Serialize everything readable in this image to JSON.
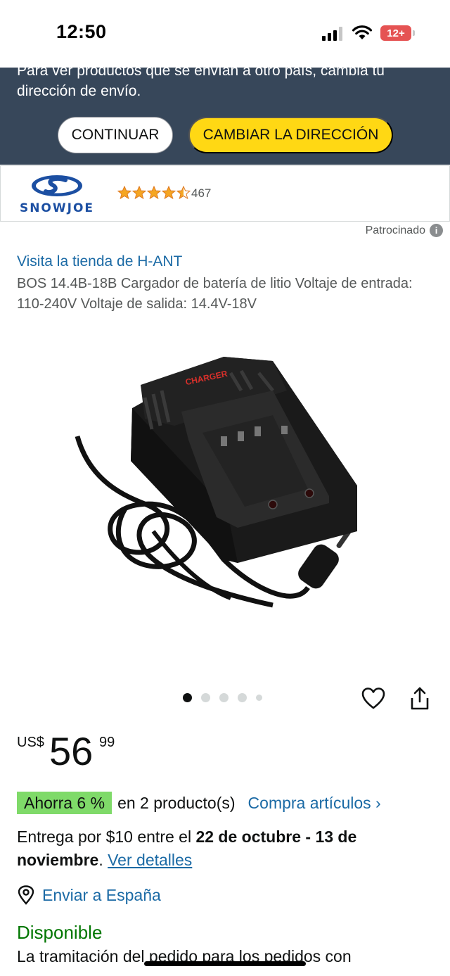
{
  "status_bar": {
    "time": "12:50",
    "battery": "12+"
  },
  "shipping_banner": {
    "message": "Para ver productos que se envían a otro país, cambia tu dirección de envío.",
    "continue_label": "CONTINUAR",
    "change_address_label": "CAMBIAR LA DIRECCIÓN"
  },
  "sponsored_ad": {
    "brand": "SNOWJOE",
    "rating_count": "467",
    "rating_stars": 4.5,
    "sponsored_label": "Patrocinado"
  },
  "product": {
    "store_link": "Visita la tienda de H-ANT",
    "title": "BOS 14.4B-18B Cargador de batería de litio Voltaje de entrada: 110-240V Voltaje de salida: 14.4V-18V",
    "image_label": "CHARGER",
    "carousel_count": 5,
    "carousel_active": 1
  },
  "price": {
    "currency": "US$",
    "whole": "56",
    "fraction": "99"
  },
  "savings": {
    "badge": "Ahorra 6 %",
    "text": "en 2 producto(s)",
    "link": "Compra artículos ›"
  },
  "delivery": {
    "prefix": "Entrega por $10 entre el ",
    "dates": "22 de octubre - 13 de noviembre",
    "suffix": ". ",
    "details_link": "Ver detalles"
  },
  "ship_to": "Enviar a España",
  "availability": "Disponible",
  "processing": "La tramitación del pedido para los pedidos con",
  "colors": {
    "banner": "#37475a",
    "yellow_button": "#ffd814",
    "link": "#1b6aa5",
    "in_stock": "#007600",
    "savings_badge": "#7fda69"
  }
}
